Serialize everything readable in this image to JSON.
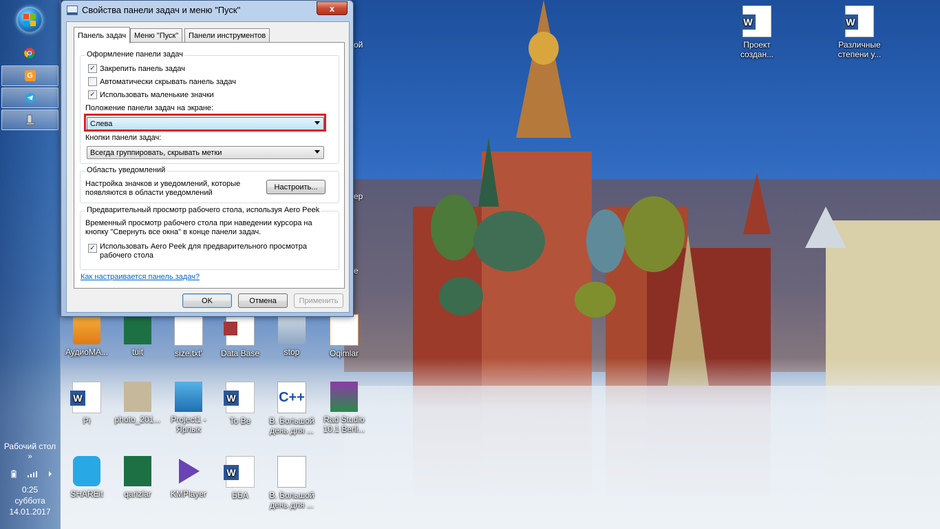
{
  "dialog": {
    "title": "Свойства панели задач и меню \"Пуск\"",
    "close_label": "x",
    "tabs": [
      {
        "label": "Панель задач"
      },
      {
        "label": "Меню \"Пуск\""
      },
      {
        "label": "Панели инструментов"
      }
    ],
    "taskbar_appearance": {
      "group_title": "Оформление панели задач",
      "lock_label": "Закрепить панель задач",
      "lock_checked": true,
      "autohide_label": "Автоматически скрывать панель задач",
      "autohide_checked": false,
      "small_icons_label": "Использовать маленькие значки",
      "small_icons_checked": true,
      "position_label": "Положение панели задач на экране:",
      "position_value": "Слева",
      "buttons_label": "Кнопки панели задач:",
      "buttons_value": "Всегда группировать, скрывать метки"
    },
    "notification_area": {
      "group_title": "Область уведомлений",
      "description": "Настройка значков и уведомлений, которые появляются в области уведомлений",
      "customize_button": "Настроить..."
    },
    "aero_peek": {
      "group_title": "Предварительный просмотр рабочего стола, используя Aero Peek",
      "description": "Временный просмотр рабочего стола при наведении курсора на кнопку \"Свернуть все окна\" в конце панели задач.",
      "use_label": "Использовать Aero Peek для предварительного просмотра рабочего стола",
      "use_checked": true
    },
    "help_link": "Как настраивается панель задач?",
    "ok_button": "OK",
    "cancel_button": "Отмена",
    "apply_button": "Применить"
  },
  "taskbar": {
    "desktop_label": "Рабочий стол",
    "expand_glyph": "»",
    "time": "0:25",
    "day": "суббота",
    "date": "14.01.2017"
  },
  "desktop_icons": [
    {
      "label": "Проект создан..."
    },
    {
      "label": "Различные степени у..."
    },
    {
      "label": "АудиоМА..."
    },
    {
      "label": "tuit"
    },
    {
      "label": "size.txt'"
    },
    {
      "label": "Data Base"
    },
    {
      "label": "stop"
    },
    {
      "label": "Oqimlar"
    },
    {
      "label": "Pi"
    },
    {
      "label": "photo_201..."
    },
    {
      "label": "Project1 - Ярлык"
    },
    {
      "label": "To Be"
    },
    {
      "label": "В. Большой день для ..."
    },
    {
      "label": "Rad Studio 10.1 Berli..."
    },
    {
      "label": "SHAREit"
    },
    {
      "label": "qarizlar"
    },
    {
      "label": "KMPlayer"
    },
    {
      "label": "ББА"
    },
    {
      "label": "В. Большой день для ..."
    }
  ],
  "peek_text": {
    "t1": "ой",
    "t2": "ер",
    "t3": "е"
  },
  "colors": {
    "highlight": "#e01e24",
    "link": "#0066cc"
  }
}
